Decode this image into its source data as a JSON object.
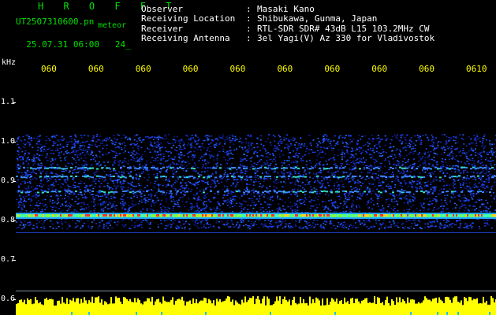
{
  "header": {
    "title": "H R O F F T",
    "filename": "UT2507310600.pn",
    "file_tag": "meteor",
    "timestamp": "25.07.31 06:00",
    "scale_hint": "24_"
  },
  "station_info": {
    "observer_label": "Observer",
    "observer_value": "Masaki Kano",
    "location_label": "Receiving Location",
    "location_value": "Shibukawa, Gunma, Japan",
    "receiver_label": "Receiver",
    "receiver_value": "RTL-SDR SDR# 43dB L15 103.2MHz CW",
    "antenna_label": "Receiving Antenna",
    "antenna_value": "3el Yagi(V) Az 330 for Vladivostok",
    "separator": ":"
  },
  "colors": {
    "background": "#000000",
    "header_green": "#00e000",
    "info_white": "#ffffff",
    "tick_yellow": "#ffff00",
    "echo_band_red": "#ff3030",
    "noise_blue": "#2040ff",
    "bottom_trace_yellow": "#ffff00"
  },
  "chart_data": {
    "type": "heatmap",
    "title": "",
    "ylabel": "kHz",
    "y_ticks": [
      "1.1",
      "1.0",
      "0.9",
      "0.8",
      "0.7",
      "0.6"
    ],
    "ylim": [
      0.6,
      1.2
    ],
    "x_ticks": [
      "060",
      "060",
      "060",
      "060",
      "060",
      "060",
      "060",
      "060",
      "060",
      "0610"
    ],
    "x_minutes": [
      0,
      1,
      2,
      3,
      4,
      5,
      6,
      7,
      8,
      9
    ],
    "noise_band_khz": [
      0.78,
      1.02
    ],
    "strong_echo_band_khz": 0.812,
    "secondary_lines_khz": [
      0.913,
      0.935,
      0.875
    ],
    "grid": false,
    "legend": "none"
  }
}
